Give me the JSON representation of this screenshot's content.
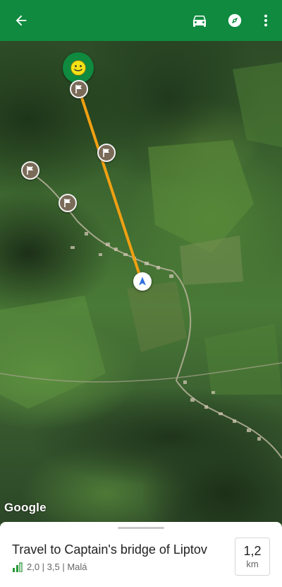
{
  "toolbar": {
    "back_icon": "arrow-left-icon",
    "car_icon": "car-icon",
    "compass_icon": "compass-icon",
    "more_icon": "more-vertical-icon",
    "color": "#0f8a3f"
  },
  "map": {
    "attribution": "Google",
    "route_color": "#f0a012",
    "markers": [
      "flag-icon",
      "flag-icon",
      "flag-icon",
      "flag-icon"
    ],
    "user_marker": "smiley-face-icon",
    "nav_marker": "navigation-arrow-icon"
  },
  "trip": {
    "title": "Travel to Captain's bridge of Liptov",
    "stats": "2,0 | 3,5 | Malá",
    "stats_icon": "difficulty-bars-icon",
    "distance_value": "1,2",
    "distance_unit": "km"
  }
}
